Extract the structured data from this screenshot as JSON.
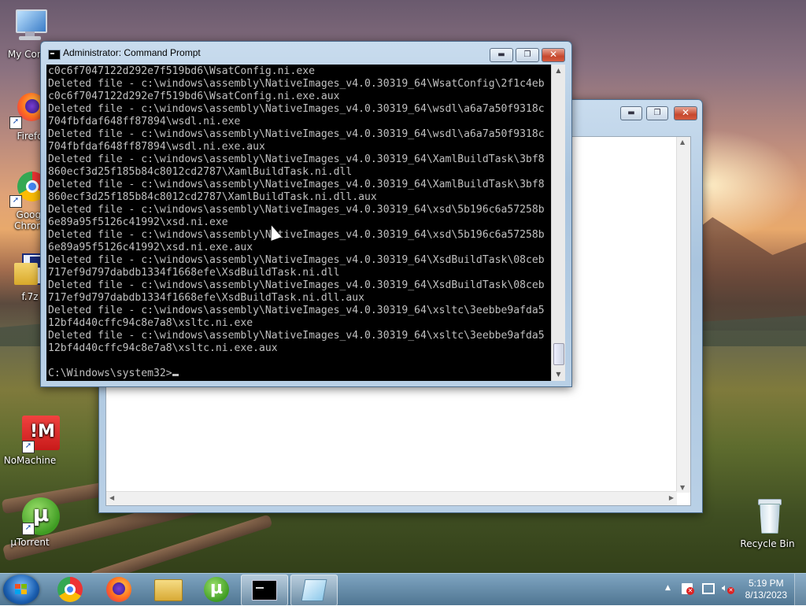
{
  "desktop": {
    "icons": [
      {
        "label": "My Comp"
      },
      {
        "label": "Firefo"
      },
      {
        "label": "Googl Chrom"
      },
      {
        "label": "f.7z"
      },
      {
        "label": "NoMachine"
      },
      {
        "label": "µTorrent"
      },
      {
        "label": "Recycle Bin"
      }
    ]
  },
  "cmd": {
    "title": "Administrator:  Command Prompt",
    "minimize": "▬",
    "restore": "❐",
    "close": "✕",
    "lines": [
      "c0c6f7047122d292e7f519bd6\\WsatConfig.ni.exe",
      "Deleted file - c:\\windows\\assembly\\NativeImages_v4.0.30319_64\\WsatConfig\\2f1c4eb",
      "c0c6f7047122d292e7f519bd6\\WsatConfig.ni.exe.aux",
      "Deleted file - c:\\windows\\assembly\\NativeImages_v4.0.30319_64\\wsdl\\a6a7a50f9318c",
      "704fbfdaf648ff87894\\wsdl.ni.exe",
      "Deleted file - c:\\windows\\assembly\\NativeImages_v4.0.30319_64\\wsdl\\a6a7a50f9318c",
      "704fbfdaf648ff87894\\wsdl.ni.exe.aux",
      "Deleted file - c:\\windows\\assembly\\NativeImages_v4.0.30319_64\\XamlBuildTask\\3bf8",
      "860ecf3d25f185b84c8012cd2787\\XamlBuildTask.ni.dll",
      "Deleted file - c:\\windows\\assembly\\NativeImages_v4.0.30319_64\\XamlBuildTask\\3bf8",
      "860ecf3d25f185b84c8012cd2787\\XamlBuildTask.ni.dll.aux",
      "Deleted file - c:\\windows\\assembly\\NativeImages_v4.0.30319_64\\xsd\\5b196c6a57258b",
      "6e89a95f5126c41992\\xsd.ni.exe",
      "Deleted file - c:\\windows\\assembly\\NativeImages_v4.0.30319_64\\xsd\\5b196c6a57258b",
      "6e89a95f5126c41992\\xsd.ni.exe.aux",
      "Deleted file - c:\\windows\\assembly\\NativeImages_v4.0.30319_64\\XsdBuildTask\\08ceb",
      "717ef9d797dabdb1334f1668efe\\XsdBuildTask.ni.dll",
      "Deleted file - c:\\windows\\assembly\\NativeImages_v4.0.30319_64\\XsdBuildTask\\08ceb",
      "717ef9d797dabdb1334f1668efe\\XsdBuildTask.ni.dll.aux",
      "Deleted file - c:\\windows\\assembly\\NativeImages_v4.0.30319_64\\xsltc\\3eebbe9afda5",
      "12bf4d40cffc94c8e7a8\\xsltc.ni.exe",
      "Deleted file - c:\\windows\\assembly\\NativeImages_v4.0.30319_64\\xsltc\\3eebbe9afda5",
      "12bf4d40cffc94c8e7a8\\xsltc.ni.exe.aux",
      "",
      "C:\\Windows\\system32>"
    ]
  },
  "notepad": {
    "minimize": "▬",
    "restore": "❐",
    "close": "✕"
  },
  "taskbar": {
    "time": "5:19 PM",
    "date": "8/13/2023",
    "tray_arrow": "▲"
  },
  "colors": {
    "console_bg": "#000000",
    "console_fg": "#c0c0c0"
  }
}
